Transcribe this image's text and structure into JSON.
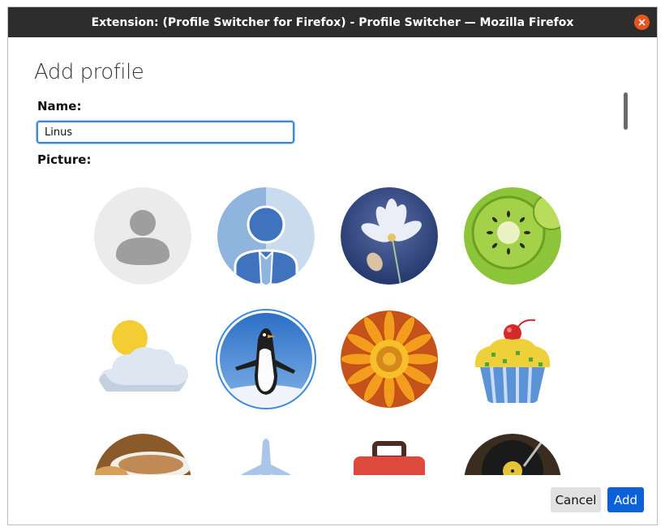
{
  "window": {
    "title": "Extension: (Profile Switcher for Firefox) - Profile Switcher — Mozilla Firefox"
  },
  "dialog": {
    "heading": "Add profile",
    "name_label": "Name:",
    "name_value": "Linus",
    "picture_label": "Picture:",
    "selected_picture": "penguin",
    "pictures": [
      {
        "name": "default-person"
      },
      {
        "name": "business-person"
      },
      {
        "name": "flower"
      },
      {
        "name": "kiwi"
      },
      {
        "name": "sun-cloud"
      },
      {
        "name": "penguin"
      },
      {
        "name": "orange-flower"
      },
      {
        "name": "cupcake"
      },
      {
        "name": "coffee"
      },
      {
        "name": "airplane"
      },
      {
        "name": "toolbox"
      },
      {
        "name": "vinyl-record"
      }
    ]
  },
  "buttons": {
    "cancel_label": "Cancel",
    "add_label": "Add"
  },
  "colors": {
    "titlebar": "#2d2d2d",
    "close": "#e95420",
    "accent": "#0b61d8",
    "focus": "#3a89e0"
  }
}
